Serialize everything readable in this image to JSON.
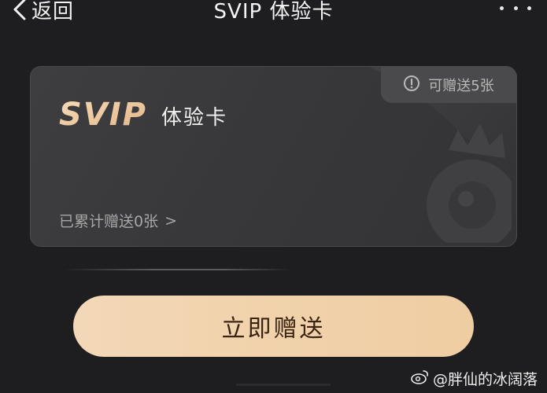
{
  "header": {
    "back_label": "返回",
    "title": "SVIP 体验卡"
  },
  "card": {
    "logo_text": "SVIP",
    "name": "体验卡",
    "badge_text": "可赠送5张",
    "sent_text": "已累计赠送0张",
    "sent_chevron": ">"
  },
  "action": {
    "button_label": "立即赠送"
  },
  "watermark": {
    "text": "@胖仙的冰阔落"
  },
  "colors": {
    "background": "#1e1e20",
    "card": "#3a3a3c",
    "accent_gold": "#f1d3ad",
    "button_text": "#3a2412"
  },
  "icons": {
    "back": "chevron-left-icon",
    "more": "more-dots-icon",
    "badge": "info-icon",
    "deco": "crown-mascot-icon",
    "watermark": "weibo-icon"
  }
}
